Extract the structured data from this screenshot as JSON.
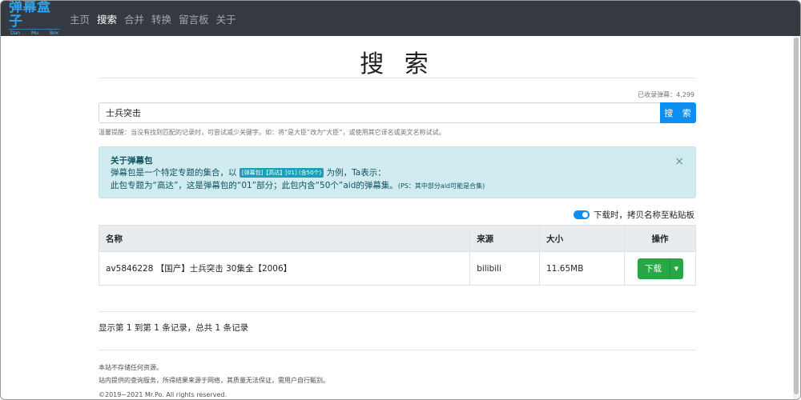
{
  "nav": {
    "logo_main": "弹幕盒子",
    "logo_sub": [
      "Dan",
      "Mu",
      "Box"
    ],
    "items": [
      {
        "label": "主页",
        "active": false
      },
      {
        "label": "搜索",
        "active": true
      },
      {
        "label": "合并",
        "active": false
      },
      {
        "label": "转换",
        "active": false
      },
      {
        "label": "留言板",
        "active": false
      },
      {
        "label": "关于",
        "active": false
      }
    ]
  },
  "page": {
    "title": "搜 索",
    "count": "已收录弹幕：4,299"
  },
  "search": {
    "value": "士兵突击",
    "button": "搜 索",
    "hint": "温馨提醒：当没有找到匹配的记录时，可尝试减少关键字。如：将“是大臣”改为“大臣”，或使用其它译名或英文名称试试。"
  },
  "alert": {
    "title": "关于弹幕包",
    "line1_prefix": "弹幕包是一个特定专题的集合，以",
    "badge": "[弹幕包]【高达】[01] (含50个)",
    "line1_suffix": "为例，Ta表示：",
    "line2": "此包专题为“高达”，这是弹幕包的“01”部分；此包内含“50个”aid的弹幕集。",
    "ps": "(PS：其中部分aid可能是合集)",
    "close": "×"
  },
  "toggle": {
    "label": "下载时，拷贝名称至粘贴板",
    "on": true
  },
  "table": {
    "headers": [
      "名称",
      "来源",
      "大小",
      "操作"
    ],
    "rows": [
      {
        "name": "av5846228 【国产】士兵突击 30集全【2006】",
        "source": "bilibili",
        "size": "11.65MB",
        "action": "下载"
      }
    ]
  },
  "summary": "显示第 1 到第 1 条记录，总共 1 条记录",
  "footer": {
    "line1": "本站不存储任何资源。",
    "line2": "站内提供的查询服务，所得结果来源于网络，其质量无法保证，需用户自行甄别。",
    "copyright": "©2019~2021 Mr.Po. All rights reserved."
  },
  "colors": {
    "navbar": "#343a40",
    "primary": "#0d8ef0",
    "success": "#28a745",
    "info_bg": "#d1ecf1",
    "info_text": "#0c5460"
  }
}
